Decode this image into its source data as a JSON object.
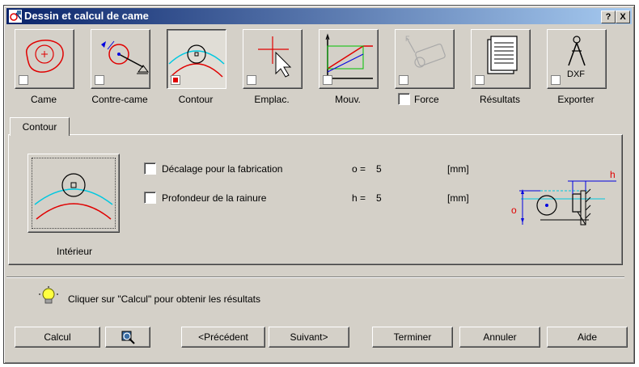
{
  "window": {
    "title": "Dessin et calcul de came",
    "help_btn": "?",
    "close_btn": "X"
  },
  "toolbar": [
    {
      "label": "Came",
      "icon": "cam-icon"
    },
    {
      "label": "Contre-came",
      "icon": "counter-cam-icon"
    },
    {
      "label": "Contour",
      "icon": "contour-icon",
      "pressed": true
    },
    {
      "label": "Emplac.",
      "icon": "placement-icon"
    },
    {
      "label": "Mouv.",
      "icon": "motion-graph-icon"
    },
    {
      "label": "Force",
      "icon": "force-icon",
      "disabled": true
    },
    {
      "label": "Résultats",
      "icon": "results-icon"
    },
    {
      "label": "Exporter",
      "icon": "export-dxf-icon",
      "sublabel": "DXF"
    }
  ],
  "tab": {
    "label": "Contour"
  },
  "contour": {
    "mode_label": "Intérieur",
    "options": [
      {
        "label": "Décalage pour la fabrication",
        "var": "o =",
        "value": "5",
        "unit": "[mm]"
      },
      {
        "label": "Profondeur de la rainure",
        "var": "h =",
        "value": "5",
        "unit": "[mm]"
      }
    ],
    "diagram_labels": {
      "h": "h",
      "o": "o"
    }
  },
  "hint": {
    "text": "Cliquer sur \"Calcul\" pour obtenir les résultats",
    "icon": "lightbulb-icon"
  },
  "buttons": {
    "calcul": "Calcul",
    "zoom_icon": "magnifier-icon",
    "prev": "<Précédent",
    "next": "Suivant>",
    "finish": "Terminer",
    "cancel": "Annuler",
    "help": "Aide"
  },
  "colors": {
    "title_start": "#0a246a",
    "title_end": "#a6caf0",
    "face": "#d4d0c8",
    "red": "#e00000",
    "cyan": "#00c8e0",
    "blue": "#0000e0"
  }
}
